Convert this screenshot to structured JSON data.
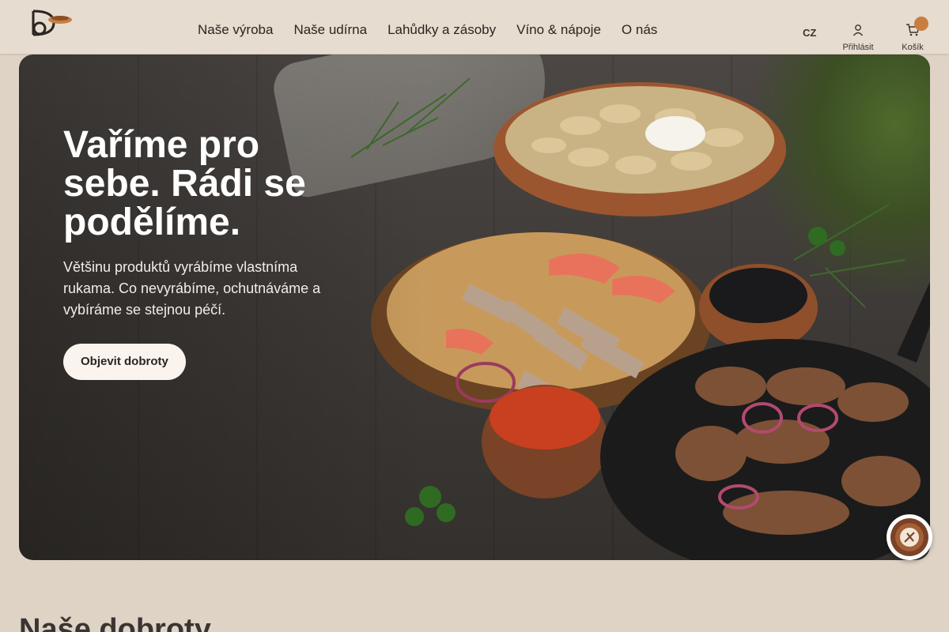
{
  "header": {
    "nav": [
      "Naše výroba",
      "Naše udírna",
      "Lahůdky a zásoby",
      "Víno & nápoje",
      "O nás"
    ],
    "lang": "CZ",
    "login_label": "Přihlásit",
    "cart_label": "Košík"
  },
  "hero": {
    "title": "Vaříme pro sebe. Rádi se podělíme.",
    "subtitle": "Většinu produktů vyrábíme vlastníma rukama. Co nevyrábíme, ochutnáváme a vybíráme se stejnou péčí.",
    "cta_label": "Objevit dobroty"
  },
  "section": {
    "title": "Naše dobroty"
  },
  "icons": {
    "logo": "dc-monogram-logo",
    "account": "user-icon",
    "cart": "cart-icon",
    "chat": "chat-assistant-icon"
  },
  "colors": {
    "background": "#dfd3c6",
    "header": "#e6dccf",
    "accent": "#c97d41",
    "button": "#faf3ee"
  }
}
